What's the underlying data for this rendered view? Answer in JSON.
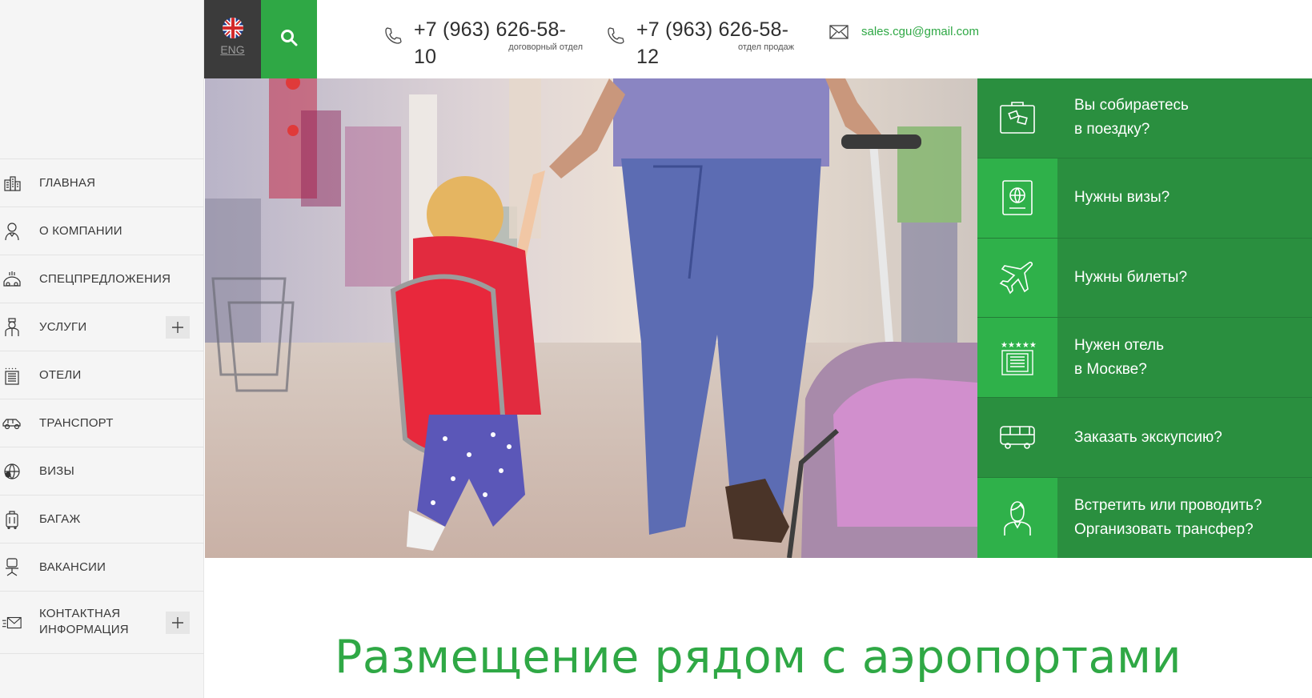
{
  "header": {
    "lang_label": "ENG",
    "phone1": {
      "number": "+7 (963) 626-58-10",
      "caption": "договорный отдел"
    },
    "phone2": {
      "number": "+7 (963) 626-58-12",
      "caption": "отдел продаж"
    },
    "email": "sales.cgu@gmail.com"
  },
  "sidebar": {
    "items": [
      {
        "label": "ГЛАВНАЯ",
        "icon": "buildings-icon"
      },
      {
        "label": "О КОМПАНИИ",
        "icon": "person-icon"
      },
      {
        "label": "СПЕЦПРЕДЛОЖЕНИЯ",
        "icon": "offer-icon"
      },
      {
        "label": "УСЛУГИ",
        "icon": "concierge-icon",
        "expandable": true
      },
      {
        "label": "ОТЕЛИ",
        "icon": "hotel-icon"
      },
      {
        "label": "ТРАНСПОРТ",
        "icon": "car-icon"
      },
      {
        "label": "ВИЗЫ",
        "icon": "globe-icon"
      },
      {
        "label": "БАГАЖ",
        "icon": "luggage-icon"
      },
      {
        "label": "ВАКАНСИИ",
        "icon": "chair-icon"
      },
      {
        "label": "КОНТАКТНАЯ\nИНФОРМАЦИЯ",
        "icon": "envelope-icon",
        "expandable": true
      }
    ]
  },
  "panel": {
    "items": [
      {
        "text": "Вы собираетесь\nв поездку?",
        "icon": "suitcase-icon"
      },
      {
        "text": "Нужны визы?",
        "icon": "passport-icon"
      },
      {
        "text": "Нужны билеты?",
        "icon": "plane-icon"
      },
      {
        "text": "Нужен отель\nв Москве?",
        "icon": "hotel-stars-icon"
      },
      {
        "text": "Заказать экскупсию?",
        "icon": "bus-icon"
      },
      {
        "text": "Встретить или проводить?\nОрганизовать трансфер?",
        "icon": "guide-icon"
      }
    ]
  },
  "main": {
    "heading": "Размещение рядом с аэропортами"
  },
  "colors": {
    "brand_green": "#2fa845",
    "panel_green": "#2a8f3f",
    "panel_active": "#2fb14a",
    "dark": "#3b3b3b"
  }
}
